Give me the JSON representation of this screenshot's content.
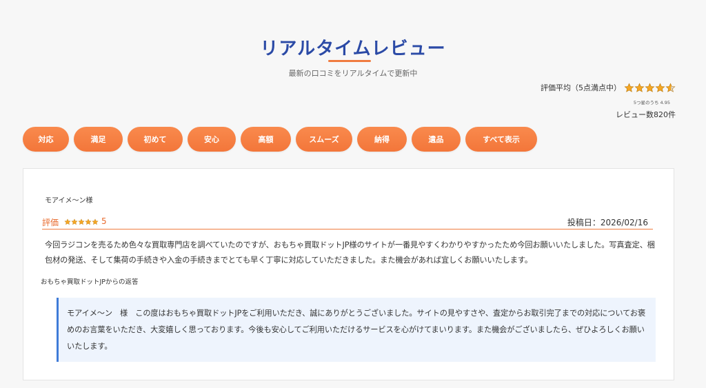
{
  "header": {
    "title": "リアルタイムレビュー",
    "subtitle": "最新の口コミをリアルタイムで更新中"
  },
  "rating_summary": {
    "label": "評価平均（5点満点中）",
    "stars_filled": 4.95,
    "stars_total": 5,
    "small_text": "5つ星のうち 4.95",
    "count_text": "レビュー数820件",
    "star_color": "#f5a623"
  },
  "tags": [
    {
      "label": "対応"
    },
    {
      "label": "満足"
    },
    {
      "label": "初めて"
    },
    {
      "label": "安心"
    },
    {
      "label": "高額"
    },
    {
      "label": "スムーズ"
    },
    {
      "label": "納得"
    },
    {
      "label": "遺品"
    },
    {
      "label": "すべて表示"
    }
  ],
  "review": {
    "reviewer": "モアイメ～ン様",
    "eval_label": "評価",
    "stars": 5,
    "score": "5",
    "post_date": "投稿日：2026/02/16",
    "body": "今回ラジコンを売るため色々な買取専門店を調べていたのですが、おもちゃ買取ドットJP様のサイトが一番見やすくわかりやすかったため今回お願いいたしました。写真査定、梱包材の発送、そして集荷の手続きや入金の手続きまでとても早く丁寧に対応していただきました。また機会があれば宜しくお願いいたします。",
    "reply_heading": "おもちゃ買取ドットJPからの返答",
    "reply": "モアイメ～ン　様　この度はおもちゃ買取ドットJPをご利用いただき、誠にありがとうございました。サイトの見やすさや、査定からお取引完了までの対応についてお褒めのお言葉をいただき、大変嬉しく思っております。今後も安心してご利用いただけるサービスを心がけてまいります。また機会がございましたら、ぜひよろしくお願いいたします。"
  },
  "colors": {
    "accent_orange": "#f3763a",
    "title_blue": "#2b4aa6",
    "reply_border": "#3f7bd8",
    "reply_bg": "#eef4fd"
  }
}
